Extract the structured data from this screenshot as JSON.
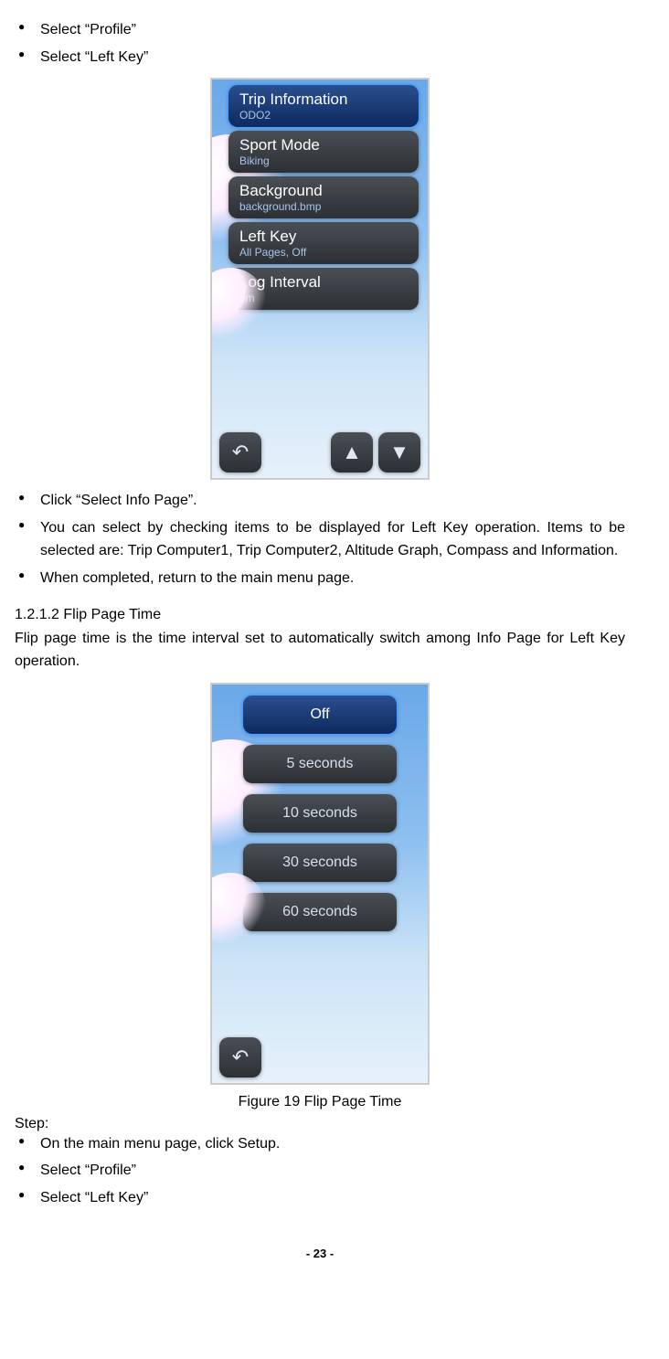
{
  "topBullets": [
    "Select “Profile”",
    "Select “Left Key”"
  ],
  "screenshot1": {
    "items": [
      {
        "title": "Trip Information",
        "sub": "ODO2",
        "active": true
      },
      {
        "title": "Sport Mode",
        "sub": "Biking",
        "active": false
      },
      {
        "title": "Background",
        "sub": "background.bmp",
        "active": false
      },
      {
        "title": "Left Key",
        "sub": "All Pages, Off",
        "active": false
      },
      {
        "title": "Log Interval",
        "sub": "5m",
        "active": false
      }
    ],
    "nav": {
      "back": "↶",
      "up": "▲",
      "down": "▼"
    }
  },
  "midBullets": [
    "Click “Select Info Page”.",
    "You can select by checking items to be displayed for Left Key operation. Items to be selected are: Trip Computer1, Trip Computer2, Altitude Graph, Compass and Information.",
    "When completed, return to the main menu page."
  ],
  "sectionHeading": "1.2.1.2 Flip Page Time",
  "sectionPara": "Flip page time is the time interval set to automatically switch among Info Page for Left Key operation.",
  "screenshot2": {
    "options": [
      {
        "label": "Off",
        "selected": true
      },
      {
        "label": "5 seconds",
        "selected": false
      },
      {
        "label": "10 seconds",
        "selected": false
      },
      {
        "label": "30 seconds",
        "selected": false
      },
      {
        "label": "60 seconds",
        "selected": false
      }
    ],
    "nav": {
      "back": "↶"
    }
  },
  "figureCaption": "Figure 19 Flip Page Time",
  "stepLabel": "Step:",
  "bottomBullets": [
    "On the main menu page, click Setup.",
    "Select “Profile”",
    "Select “Left Key”"
  ],
  "pageNumber": "- 23 -"
}
